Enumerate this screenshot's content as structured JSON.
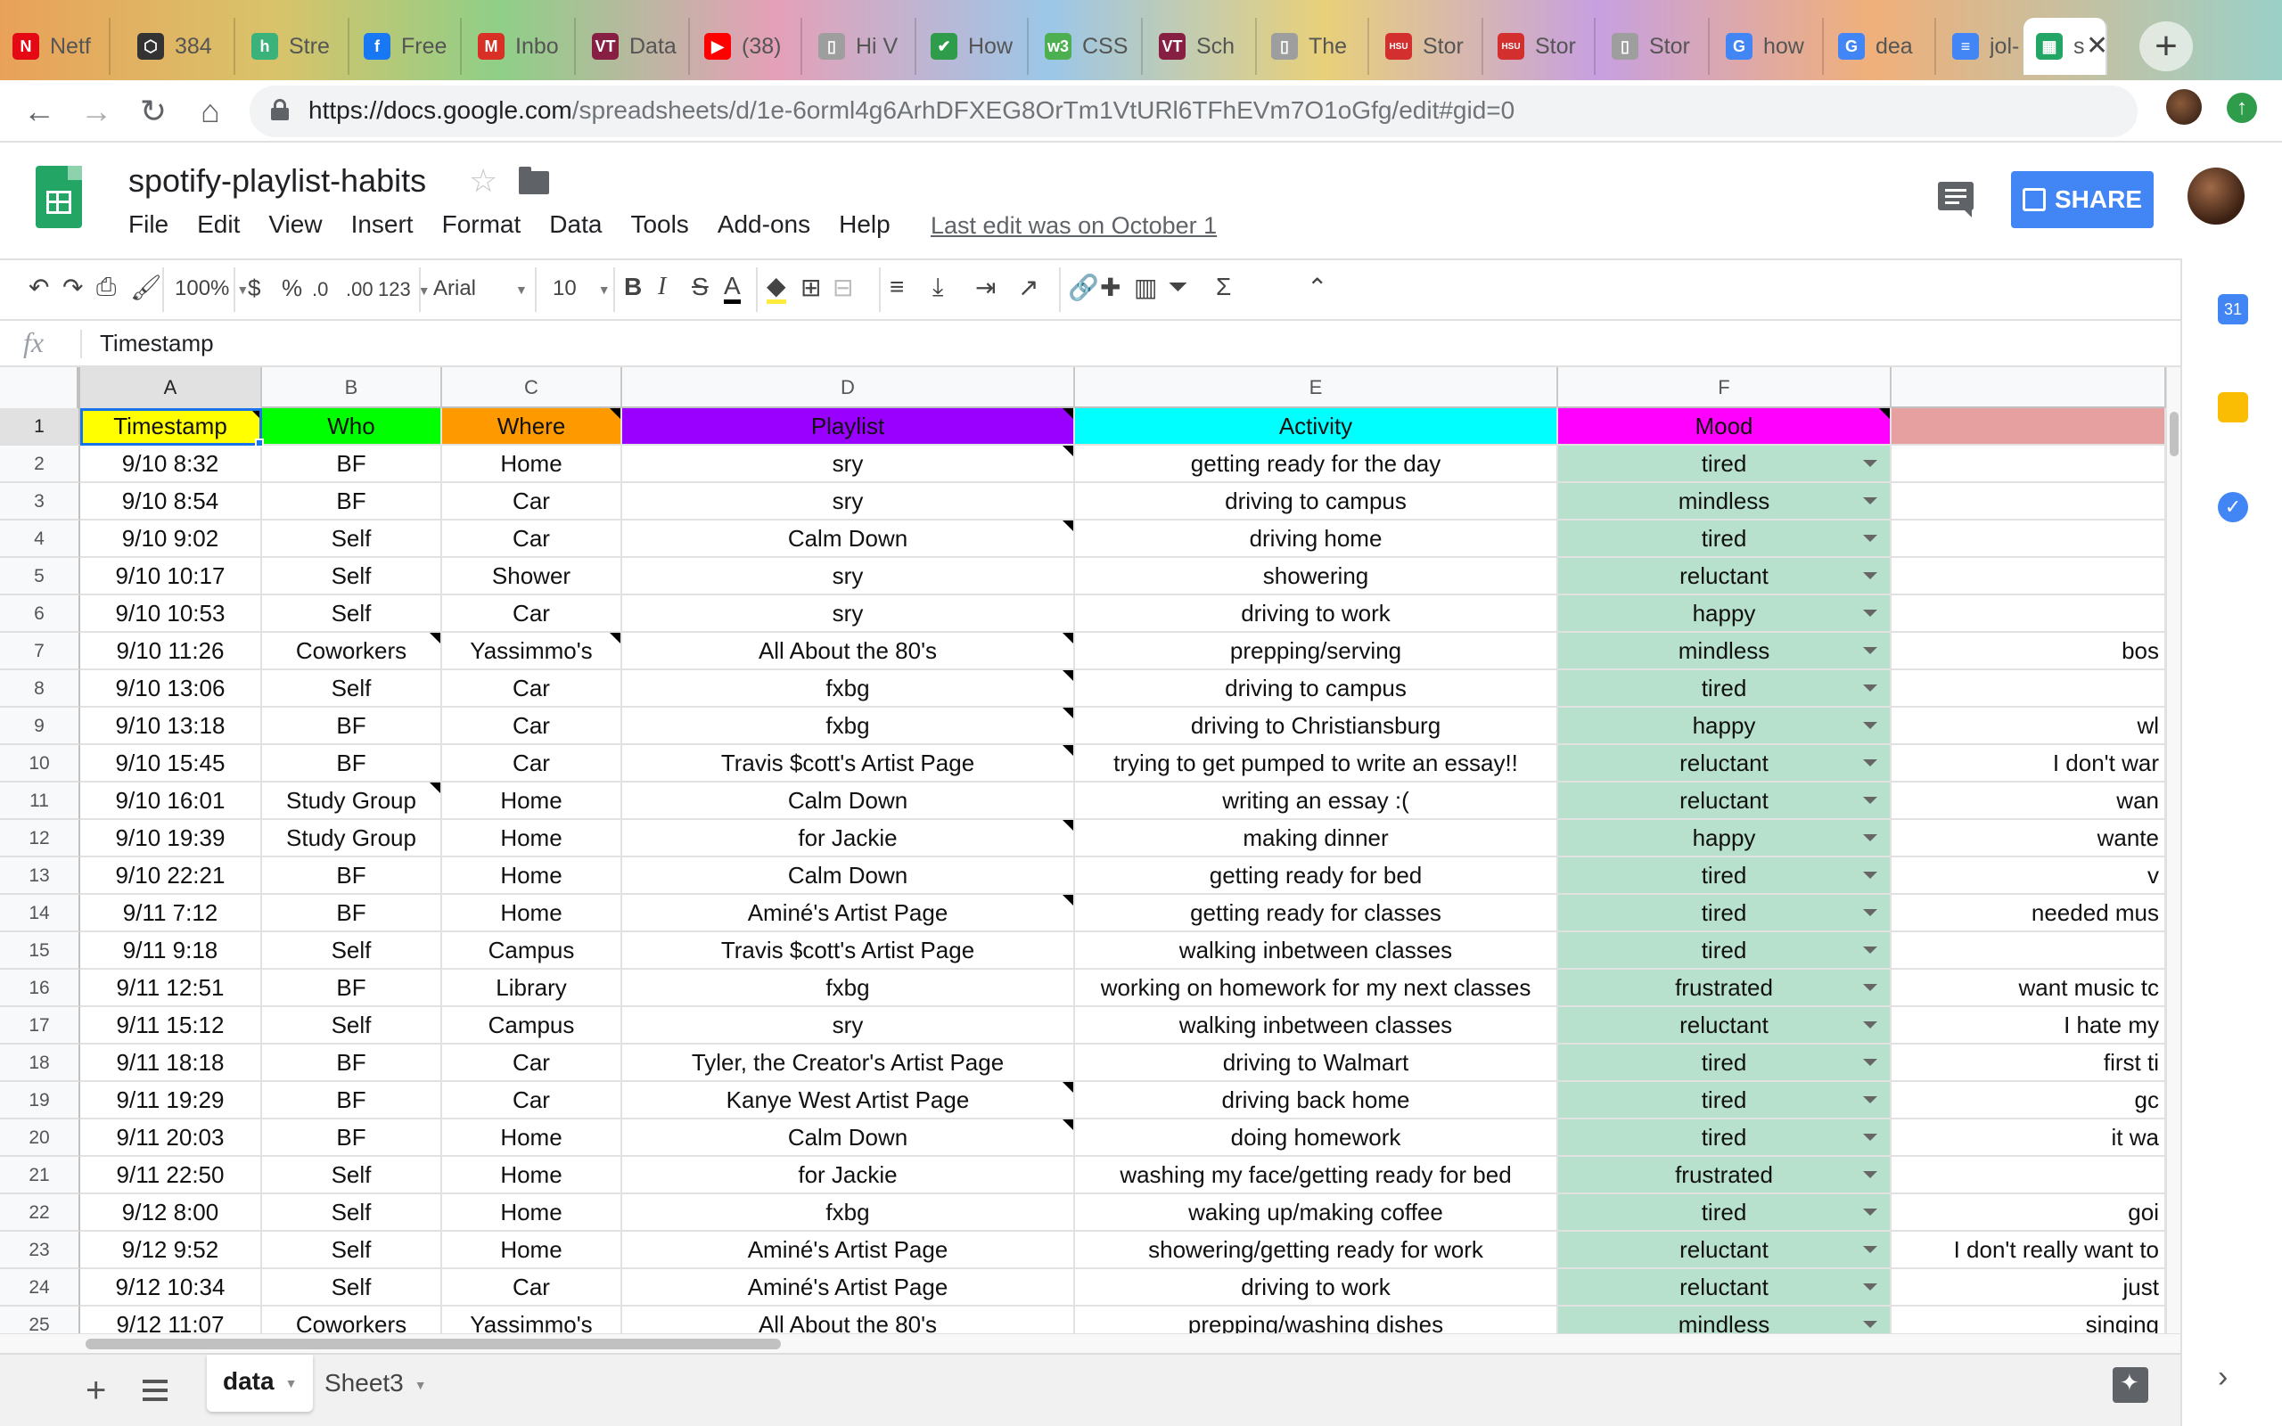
{
  "browser": {
    "tabs": [
      {
        "label": "Netf",
        "favicon": "N",
        "color": "#e50914"
      },
      {
        "label": "384",
        "favicon": "⬡",
        "color": "#333333"
      },
      {
        "label": "Stre",
        "favicon": "h",
        "color": "#3bb27a"
      },
      {
        "label": "Free",
        "favicon": "f",
        "color": "#1877f2"
      },
      {
        "label": "Inbo",
        "favicon": "M",
        "color": "#d93025"
      },
      {
        "label": "Data",
        "favicon": "VT",
        "color": "#861f41"
      },
      {
        "label": "(38)",
        "favicon": "▶",
        "color": "#ff0000"
      },
      {
        "label": "Hi V",
        "favicon": "▯",
        "color": "#9e9e9e"
      },
      {
        "label": "How",
        "favicon": "✔",
        "color": "#2e9c4a"
      },
      {
        "label": "CSS",
        "favicon": "w3",
        "color": "#4caf50"
      },
      {
        "label": "Sch",
        "favicon": "VT",
        "color": "#861f41"
      },
      {
        "label": "The",
        "favicon": "▯",
        "color": "#9e9e9e"
      },
      {
        "label": "Stor",
        "favicon": "HSU",
        "color": "#d32f2f"
      },
      {
        "label": "Stor",
        "favicon": "HSU",
        "color": "#d32f2f"
      },
      {
        "label": "Stor",
        "favicon": "▯",
        "color": "#9e9e9e"
      },
      {
        "label": "how",
        "favicon": "G",
        "color": "#4285f4"
      },
      {
        "label": "dea",
        "favicon": "G",
        "color": "#4285f4"
      },
      {
        "label": "jol-",
        "favicon": "≡",
        "color": "#4285f4"
      },
      {
        "label": "s",
        "favicon": "▦",
        "color": "#23a566"
      }
    ],
    "url_host": "https://docs.google.com",
    "url_path": "/spreadsheets/d/1e-6orml4g6ArhDFXEG8OrTm1VtURl6TFhEVm7O1oGfg/edit#gid=0"
  },
  "doc": {
    "title": "spotify-playlist-habits",
    "menu": [
      "File",
      "Edit",
      "View",
      "Insert",
      "Format",
      "Data",
      "Tools",
      "Add-ons",
      "Help"
    ],
    "last_edit": "Last edit was on October 1",
    "share_label": "SHARE"
  },
  "toolbar": {
    "zoom": "100%",
    "currency": "$",
    "percent": "%",
    "dec_less": ".0",
    "dec_more": ".00",
    "more_formats": "123",
    "font": "Arial",
    "font_size": "10",
    "bold": "B",
    "italic": "I",
    "strike": "S",
    "text_color": "A",
    "sum": "Σ"
  },
  "formula_bar": {
    "fx": "fx",
    "value": "Timestamp"
  },
  "columns": [
    "A",
    "B",
    "C",
    "D",
    "E",
    "F",
    ""
  ],
  "headers": [
    "Timestamp",
    "Who",
    "Where",
    "Playlist",
    "Activity",
    "Mood",
    ""
  ],
  "header_colors": [
    "#ffff00",
    "#00ff00",
    "#ff9900",
    "#9900ff",
    "#00ffff",
    "#ff00ff",
    "#e6a0a0"
  ],
  "rows": [
    {
      "n": "2",
      "c": [
        "9/10 8:32",
        "BF",
        "Home",
        "sry",
        "getting ready for the day",
        "tired",
        ""
      ]
    },
    {
      "n": "3",
      "c": [
        "9/10 8:54",
        "BF",
        "Car",
        "sry",
        "driving to campus",
        "mindless",
        ""
      ]
    },
    {
      "n": "4",
      "c": [
        "9/10 9:02",
        "Self",
        "Car",
        "Calm Down",
        "driving home",
        "tired",
        ""
      ]
    },
    {
      "n": "5",
      "c": [
        "9/10 10:17",
        "Self",
        "Shower",
        "sry",
        "showering",
        "reluctant",
        ""
      ]
    },
    {
      "n": "6",
      "c": [
        "9/10 10:53",
        "Self",
        "Car",
        "sry",
        "driving to work",
        "happy",
        ""
      ]
    },
    {
      "n": "7",
      "c": [
        "9/10 11:26",
        "Coworkers",
        "Yassimmo's",
        "All About the 80's",
        "prepping/serving",
        "mindless",
        "bos"
      ]
    },
    {
      "n": "8",
      "c": [
        "9/10 13:06",
        "Self",
        "Car",
        "fxbg",
        "driving to campus",
        "tired",
        ""
      ]
    },
    {
      "n": "9",
      "c": [
        "9/10 13:18",
        "BF",
        "Car",
        "fxbg",
        "driving to Christiansburg",
        "happy",
        "wl"
      ]
    },
    {
      "n": "10",
      "c": [
        "9/10 15:45",
        "BF",
        "Car",
        "Travis $cott's Artist Page",
        "trying to get pumped to write an essay!!",
        "reluctant",
        "I don't war"
      ]
    },
    {
      "n": "11",
      "c": [
        "9/10 16:01",
        "Study Group",
        "Home",
        "Calm Down",
        "writing an essay :(",
        "reluctant",
        "wan"
      ]
    },
    {
      "n": "12",
      "c": [
        "9/10 19:39",
        "Study Group",
        "Home",
        "for Jackie",
        "making dinner",
        "happy",
        "wante"
      ]
    },
    {
      "n": "13",
      "c": [
        "9/10 22:21",
        "BF",
        "Home",
        "Calm Down",
        "getting ready for bed",
        "tired",
        "v"
      ]
    },
    {
      "n": "14",
      "c": [
        "9/11 7:12",
        "BF",
        "Home",
        "Aminé's Artist Page",
        "getting ready for classes",
        "tired",
        "needed mus"
      ]
    },
    {
      "n": "15",
      "c": [
        "9/11 9:18",
        "Self",
        "Campus",
        "Travis $cott's Artist Page",
        "walking inbetween classes",
        "tired",
        ""
      ]
    },
    {
      "n": "16",
      "c": [
        "9/11 12:51",
        "BF",
        "Library",
        "fxbg",
        "working on homework for my next classes",
        "frustrated",
        "want music tc"
      ]
    },
    {
      "n": "17",
      "c": [
        "9/11 15:12",
        "Self",
        "Campus",
        "sry",
        "walking inbetween classes",
        "reluctant",
        "I hate my"
      ]
    },
    {
      "n": "18",
      "c": [
        "9/11 18:18",
        "BF",
        "Car",
        "Tyler, the Creator's Artist Page",
        "driving to Walmart",
        "tired",
        "first ti"
      ]
    },
    {
      "n": "19",
      "c": [
        "9/11 19:29",
        "BF",
        "Car",
        "Kanye West Artist Page",
        "driving back home",
        "tired",
        "gc"
      ]
    },
    {
      "n": "20",
      "c": [
        "9/11 20:03",
        "BF",
        "Home",
        "Calm Down",
        "doing homework",
        "tired",
        "it wa"
      ]
    },
    {
      "n": "21",
      "c": [
        "9/11 22:50",
        "Self",
        "Home",
        "for Jackie",
        "washing my face/getting ready for bed",
        "frustrated",
        ""
      ]
    },
    {
      "n": "22",
      "c": [
        "9/12 8:00",
        "Self",
        "Home",
        "fxbg",
        "waking up/making coffee",
        "tired",
        "goi"
      ]
    },
    {
      "n": "23",
      "c": [
        "9/12 9:52",
        "Self",
        "Home",
        "Aminé's Artist Page",
        "showering/getting ready for work",
        "reluctant",
        "I don't really want to"
      ]
    },
    {
      "n": "24",
      "c": [
        "9/12 10:34",
        "Self",
        "Car",
        "Aminé's Artist Page",
        "driving to work",
        "reluctant",
        "just"
      ]
    },
    {
      "n": "25",
      "c": [
        "9/12 11:07",
        "Coworkers",
        "Yassimmo's",
        "All About the 80's",
        "prepping/washing dishes",
        "mindless",
        "singing"
      ]
    }
  ],
  "header_row_num": "1",
  "sheet_tabs": [
    "data",
    "Sheet3"
  ],
  "colors": {
    "mood_fill": "#b7e1cd",
    "selection": "#1a73e8",
    "share": "#4285f4"
  }
}
